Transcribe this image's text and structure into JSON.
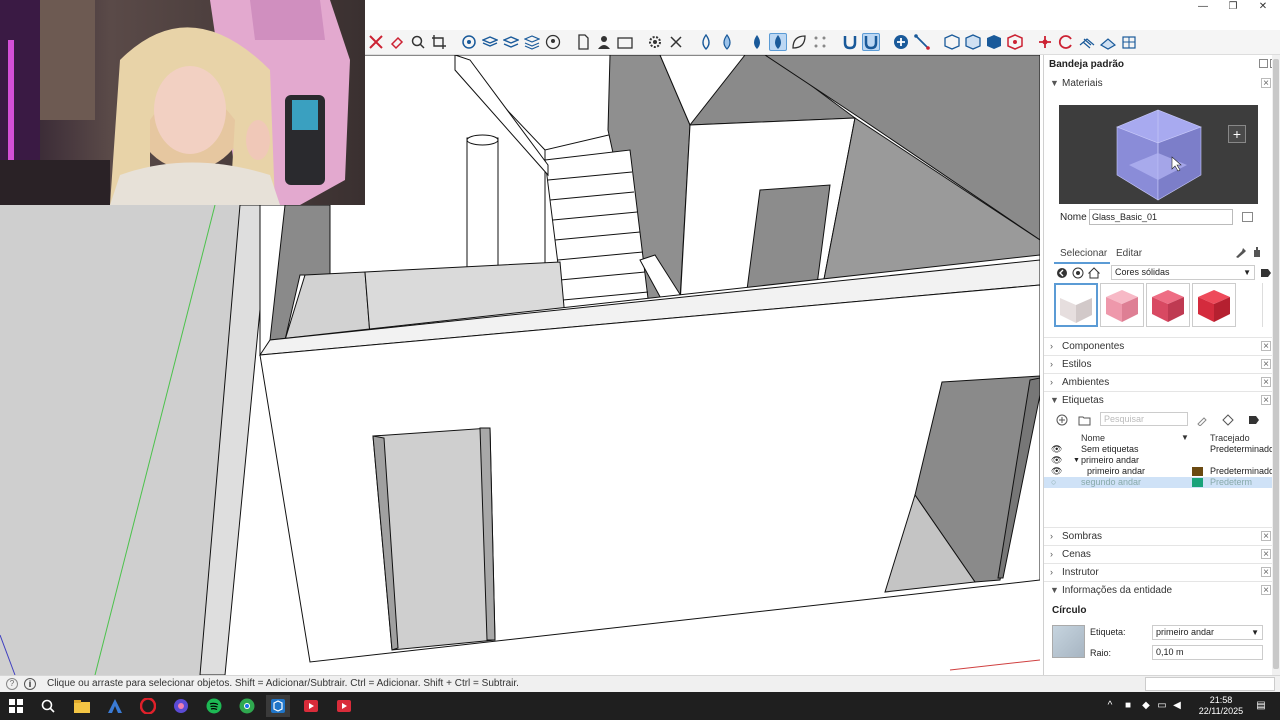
{
  "window": {
    "minimize": "—",
    "restore": "❐",
    "close": "✕"
  },
  "toolbar": {
    "icons": [
      "pencil-cross-icon",
      "eraser-icon",
      "search-icon",
      "crop-icon",
      "bucket-icon",
      "layers-icon",
      "layers2-icon",
      "layers3-icon",
      "circle-user-icon",
      "page-icon",
      "person-icon",
      "rectangle-icon",
      "gear-icon",
      "cross-icon",
      "drop-icon",
      "drop2-icon",
      "drop3-icon",
      "drop-active-icon",
      "leaf-icon",
      "dots-icon",
      "magnet-icon",
      "magnet-active-icon",
      "add-circle-icon",
      "line-icon",
      "cube-icon",
      "cube2-icon",
      "hex-icon",
      "hex2-icon",
      "nodes-icon",
      "refresh-icon",
      "mesh-icon",
      "mesh2-icon",
      "mesh3-icon"
    ]
  },
  "status": {
    "text": "Clique ou arraste para selecionar objetos. Shift = Adicionar/Subtrair. Ctrl = Adicionar. Shift + Ctrl = Subtrair."
  },
  "tray": {
    "title": "Bandeja padrão",
    "materials": {
      "label": "Materiais",
      "name_label": "Nome",
      "name_value": "Glass_Basic_01",
      "tab_select": "Selecionar",
      "tab_edit": "Editar",
      "library": "Cores sólidas",
      "swatch_colors": [
        "#f4f1f1",
        "#f2a3b3",
        "#e04a64",
        "#dd2a3c"
      ]
    },
    "sections": {
      "componentes": "Componentes",
      "estilos": "Estilos",
      "ambientes": "Ambientes",
      "etiquetas": "Etiquetas",
      "sombras": "Sombras",
      "cenas": "Cenas",
      "instrutor": "Instrutor",
      "entidade": "Informações da entidade"
    },
    "tags": {
      "search_placeholder": "Pesquisar",
      "col_name": "Nome",
      "col_dash": "Tracejado",
      "rows": [
        {
          "name": "Sem etiquetas",
          "dash": "Predeterminado",
          "color": ""
        },
        {
          "name": "primeiro andar",
          "dash": "",
          "color": ""
        },
        {
          "name": "primeiro andar",
          "dash": "Predeterminado",
          "color": "#6b4a12"
        },
        {
          "name": "segundo andar",
          "dash": "Predeterm",
          "color": "#1aa37a"
        }
      ]
    },
    "entity": {
      "title": "Círculo",
      "tag_label": "Etiqueta:",
      "tag_value": "primeiro andar",
      "radius_label": "Raio:",
      "radius_value": "0,10 m"
    }
  },
  "taskbar": {
    "time": "21:58",
    "date": "22/11/2025"
  }
}
